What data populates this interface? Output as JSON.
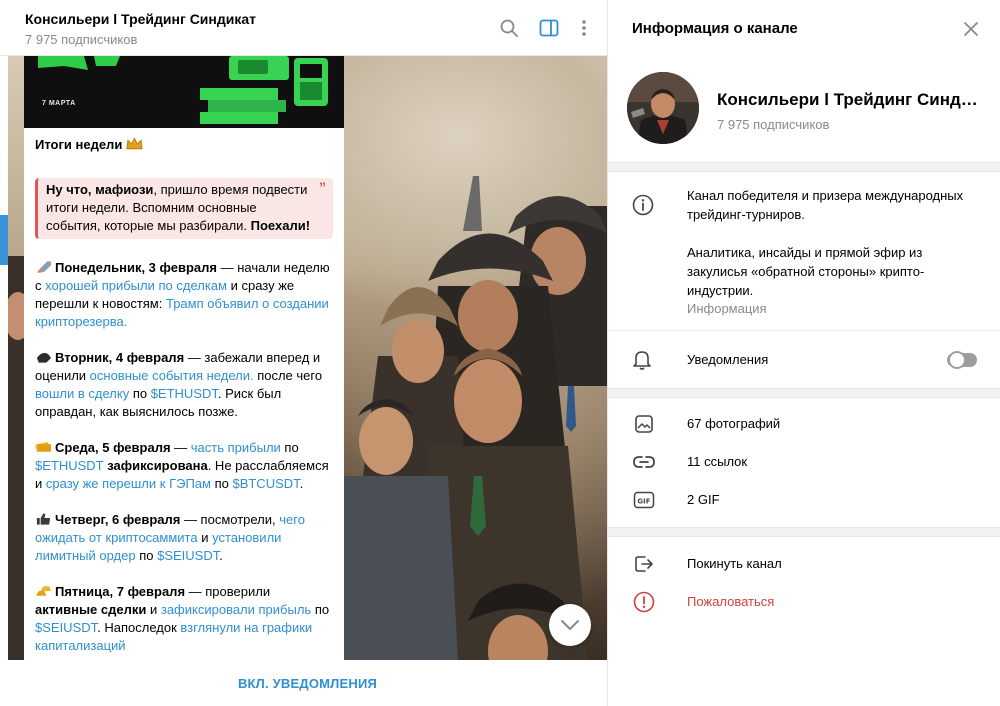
{
  "chat": {
    "title": "Консильери l Трейдинг Синдикат",
    "subscribers": "7 975 подписчиков",
    "notify_button": "ВКЛ. УВЕДОМЛЕНИЯ",
    "icons": [
      "search-icon",
      "sidebar-toggle-icon",
      "more-vertical-icon"
    ]
  },
  "message": {
    "image_date": "7 МАРТА",
    "weekly_title": "Итоги недели",
    "quote": {
      "part1_bold": "Ну что, мафиози",
      "part2": ", пришло время подвести итоги недели. Вспомним основные события, которые мы разбирали. ",
      "part3_bold": "Поехали!"
    },
    "days": [
      {
        "label": "Понедельник, 3 февраля",
        "t1": " — начали неделю с ",
        "l1": "хорошей прибыли по сделкам",
        "t2": " и сразу же перешли к новостям: ",
        "l2": "Трамп объявил о создании крипторезерва."
      },
      {
        "label": "Вторник, 4 февраля",
        "t1": " — забежали вперед и оценили ",
        "l1": "основные события недели.",
        "t2": " после чего ",
        "l2": "вошли в сделку",
        "t3": " по ",
        "l3": "$ETHUSDT",
        "t4": ". Риск был оправдан, как выяснилось позже."
      },
      {
        "label": "Среда, 5 февраля",
        "t1": " — ",
        "l1": "часть прибыли",
        "t2": " по ",
        "l2": "$ETHUSDT",
        "b2": " зафиксирована",
        "t3": ". Не расслабляемся и ",
        "l3": "сразу же перешли к ГЭПам",
        "t4": " по ",
        "l4": "$BTCUSDT",
        "t5": "."
      },
      {
        "label": "Четверг, 6 февраля",
        "t1": " — посмотрели, ",
        "l1": "чего ожидать от криптосаммита",
        "t2": " и ",
        "l2": "установили лимитный ордер",
        "t3": " по ",
        "l3": "$SEIUSDT",
        "t4": "."
      },
      {
        "label": "Пятница, 7 февраля",
        "t1": " — проверили ",
        "b1": "активные сделки",
        "t2": " и ",
        "l2": "зафиксировали прибыль",
        "t3": " по ",
        "l3": "$SEIUSDT",
        "t4": ". Напоследок ",
        "l4": "взглянули на графики капитализаций"
      }
    ]
  },
  "info": {
    "title": "Информация о канале",
    "name": "Консильери l Трейдинг Синдикат",
    "subscribers": "7 975 подписчиков",
    "about_line1": "Канал победителя и призера международных трейдинг-турниров.",
    "about_line2": "Аналитика, инсайды и прямой эфир из закулисья «обратной стороны» крипто-индустрии.",
    "about_caption": "Информация",
    "notifications_label": "Уведомления",
    "notifications_on": false,
    "photos": "67 фотографий",
    "links": "11 ссылок",
    "gifs": "2 GIF",
    "leave": "Покинуть канал",
    "report": "Пожаловаться"
  },
  "colors": {
    "accent": "#2f8fd1",
    "danger": "#d64040",
    "quote_bg": "#fbe6e6",
    "quote_bar": "#e05656"
  }
}
